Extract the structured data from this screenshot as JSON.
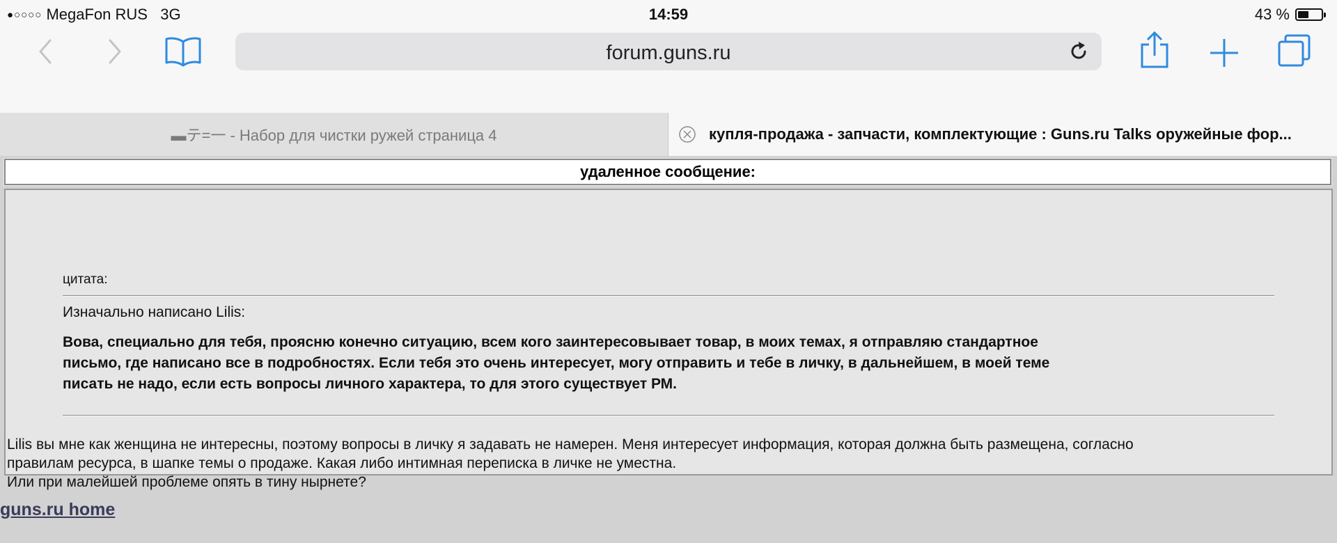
{
  "status_bar": {
    "signal_dots": "●○○○○",
    "carrier": "MegaFon RUS",
    "network": "3G",
    "time": "14:59",
    "battery_percent": "43 %",
    "battery_level": 0.43
  },
  "toolbar": {
    "url": "forum.guns.ru",
    "accent_color": "#2f8ae0",
    "icons": [
      "back-icon",
      "forward-icon",
      "bookmarks-icon",
      "reload-icon",
      "share-icon",
      "new-tab-icon",
      "tabs-icon"
    ]
  },
  "tabs": {
    "inactive_title": "▬テ=一 - Набор для чистки ружей страница 4",
    "active_title": "купля-продажа - запчасти, комплектующие : Guns.ru Talks оружейные фор..."
  },
  "page": {
    "header": "удаленное сообщение:",
    "quote_label": "цитата:",
    "quote_author": "Изначально написано Lilis:",
    "quote_lines": [
      "Вова, специально для тебя, проясню конечно ситуацию, всем кого заинтересовывает товар, в моих темах, я отправляю стандартное",
      "письмо, где написано все в подробностях. Если тебя это очень интересует, могу отправить и тебе в личку, в дальнейшем, в моей теме",
      "писать не надо, если есть вопросы личного характера, то для этого существует РМ."
    ],
    "reply_lines": [
      "Lilis вы мне как женщина не интересны, поэтому вопросы в личку я задавать не намерен. Меня интересует информация, которая должна быть размещена, согласно",
      "правилам ресурса, в шапке темы о продаже. Какая либо интимная переписка в личке не уместна.",
      "Или при малейшей проблеме опять в тину нырнете?"
    ],
    "home_link": "guns.ru home"
  }
}
